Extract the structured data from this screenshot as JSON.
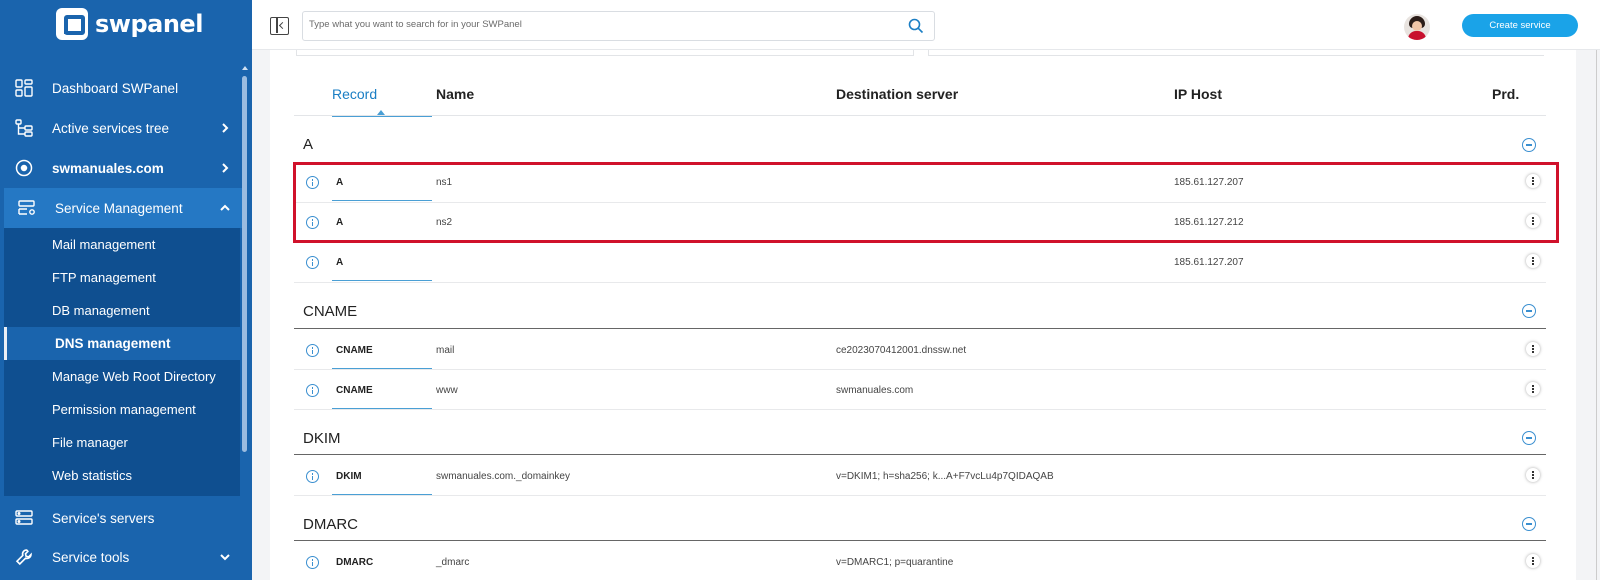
{
  "sidebar": {
    "logo_text": "swpanel",
    "items": [
      {
        "label": "Dashboard SWPanel",
        "icon": "dashboard-grid-icon"
      },
      {
        "label": "Active services tree",
        "icon": "tree-icon"
      },
      {
        "label": "swmanuales.com",
        "icon": "target-icon"
      },
      {
        "label": "Service Management",
        "icon": "server-settings-icon"
      },
      {
        "label": "Service's servers",
        "icon": "servers-icon"
      },
      {
        "label": "Service tools",
        "icon": "wrench-icon"
      }
    ],
    "submenu": [
      {
        "label": "Mail management"
      },
      {
        "label": "FTP management"
      },
      {
        "label": "DB management"
      },
      {
        "label": "DNS management"
      },
      {
        "label": "Manage Web Root Directory"
      },
      {
        "label": "Permission management"
      },
      {
        "label": "File manager"
      },
      {
        "label": "Web statistics"
      }
    ]
  },
  "topbar": {
    "search_placeholder": "Type what you want to search for in your SWPanel",
    "create_label": "Create service"
  },
  "table": {
    "headers": [
      "Record",
      "Name",
      "Destination server",
      "IP Host",
      "Prd."
    ],
    "groups": [
      {
        "title": "A",
        "rows": [
          {
            "type": "A",
            "name": "ns1",
            "dest": "",
            "ip": "185.61.127.207"
          },
          {
            "type": "A",
            "name": "ns2",
            "dest": "",
            "ip": "185.61.127.212"
          },
          {
            "type": "A",
            "name": "",
            "dest": "",
            "ip": "185.61.127.207"
          }
        ]
      },
      {
        "title": "CNAME",
        "rows": [
          {
            "type": "CNAME",
            "name": "mail",
            "dest": "ce2023070412001.dnssw.net",
            "ip": ""
          },
          {
            "type": "CNAME",
            "name": "www",
            "dest": "swmanuales.com",
            "ip": ""
          }
        ]
      },
      {
        "title": "DKIM",
        "rows": [
          {
            "type": "DKIM",
            "name": "swmanuales.com._domainkey",
            "dest": "v=DKIM1; h=sha256; k...A+F7vcLu4p7QIDAQAB",
            "ip": ""
          }
        ]
      },
      {
        "title": "DMARC",
        "rows": [
          {
            "type": "DMARC",
            "name": "_dmarc",
            "dest": "v=DMARC1; p=quarantine",
            "ip": ""
          }
        ]
      }
    ]
  },
  "colors": {
    "sidebar": "#1a64ad",
    "submenu": "#0f4f90",
    "accent": "#1a7ec4",
    "highlight": "#d0112b",
    "create_button": "#1aa3e8"
  }
}
